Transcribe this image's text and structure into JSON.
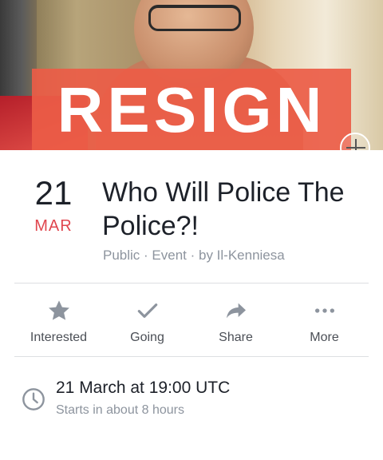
{
  "cover": {
    "overlay_text": "RESIGN"
  },
  "event": {
    "day": "21",
    "month": "MAR",
    "title": "Who Will Police The Police?!",
    "meta": "Public · Event · by Il-Kenniesa"
  },
  "actions": [
    {
      "label": "Interested",
      "icon": "star-icon"
    },
    {
      "label": "Going",
      "icon": "check-icon"
    },
    {
      "label": "Share",
      "icon": "share-arrow-icon"
    },
    {
      "label": "More",
      "icon": "more-dots-icon"
    }
  ],
  "schedule": {
    "time": "21 March at 19:00 UTC",
    "relative": "Starts in about 8 hours",
    "icon": "clock-icon"
  },
  "colors": {
    "accent_red": "#e0464e",
    "icon_gray": "#8d949e",
    "overlay": "#ec5c46"
  }
}
